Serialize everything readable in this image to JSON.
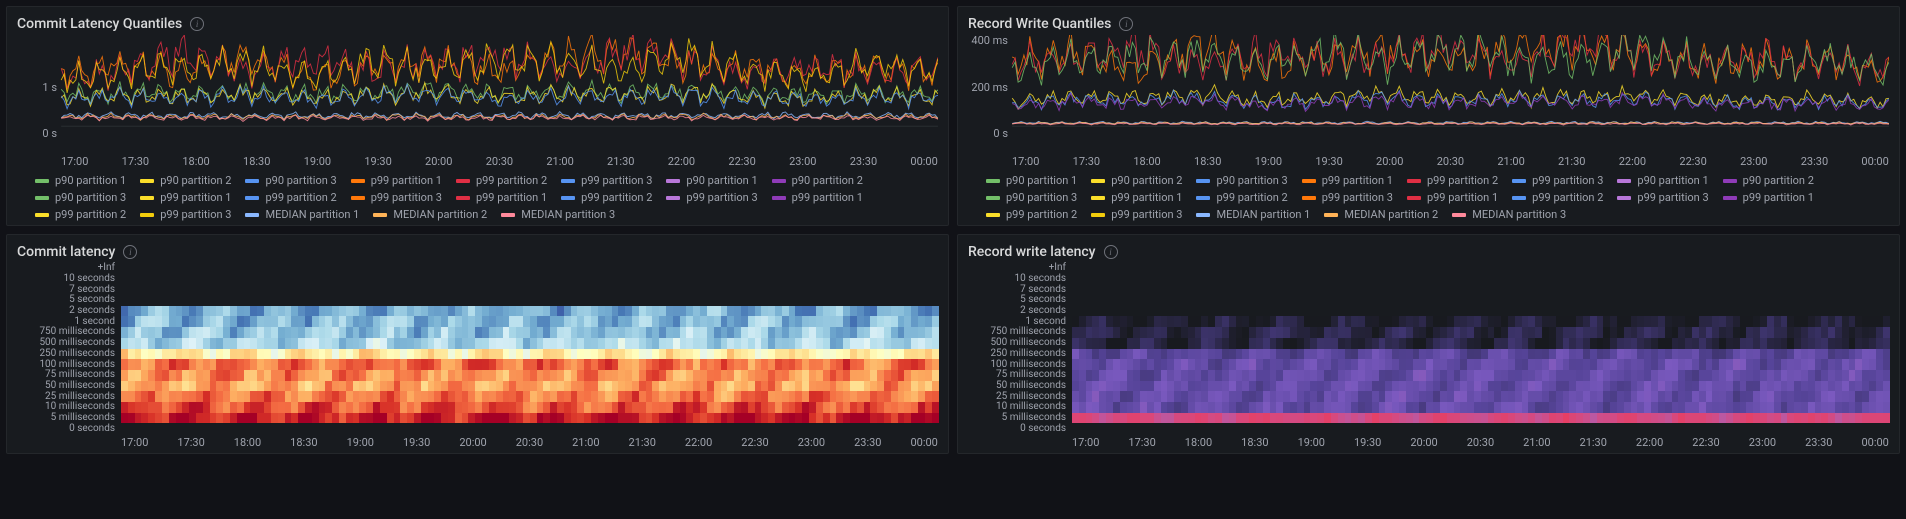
{
  "time_ticks": [
    "17:00",
    "17:30",
    "18:00",
    "18:30",
    "19:00",
    "19:30",
    "20:00",
    "20:30",
    "21:00",
    "21:30",
    "22:00",
    "22:30",
    "23:00",
    "23:30",
    "00:00"
  ],
  "panels": {
    "commit_quantiles": {
      "title": "Commit Latency Quantiles",
      "y_ticks": [
        "1 s",
        "0 s"
      ],
      "legend": [
        {
          "label": "p90 partition 1",
          "color": "#73BF69"
        },
        {
          "label": "p90 partition 2",
          "color": "#FADE2A"
        },
        {
          "label": "p90 partition 3",
          "color": "#5794F2"
        },
        {
          "label": "p99 partition 1",
          "color": "#FF780A"
        },
        {
          "label": "p99 partition 2",
          "color": "#E02F44"
        },
        {
          "label": "p99 partition 3",
          "color": "#5794F2"
        },
        {
          "label": "p90 partition 1",
          "color": "#B877D9"
        },
        {
          "label": "p90 partition 2",
          "color": "#8F3BB8"
        },
        {
          "label": "p90 partition 3",
          "color": "#73BF69"
        },
        {
          "label": "p99 partition 1",
          "color": "#FADE2A"
        },
        {
          "label": "p99 partition 2",
          "color": "#5794F2"
        },
        {
          "label": "p99 partition 3",
          "color": "#FF780A"
        },
        {
          "label": "p99 partition 1",
          "color": "#E02F44"
        },
        {
          "label": "p99 partition 2",
          "color": "#5794F2"
        },
        {
          "label": "p99 partition 3",
          "color": "#B877D9"
        },
        {
          "label": "p99 partition 1",
          "color": "#8F3BB8"
        },
        {
          "label": "p99 partition 2",
          "color": "#FADE2A"
        },
        {
          "label": "p99 partition 3",
          "color": "#F2CC0C"
        },
        {
          "label": "MEDIAN partition 1",
          "color": "#8AB8FF"
        },
        {
          "label": "MEDIAN partition 2",
          "color": "#FFB357"
        },
        {
          "label": "MEDIAN partition 3",
          "color": "#FF899B"
        }
      ]
    },
    "record_quantiles": {
      "title": "Record Write Quantiles",
      "y_ticks": [
        "400 ms",
        "200 ms",
        "0 s"
      ],
      "legend": [
        {
          "label": "p90 partition 1",
          "color": "#73BF69"
        },
        {
          "label": "p90 partition 2",
          "color": "#FADE2A"
        },
        {
          "label": "p90 partition 3",
          "color": "#5794F2"
        },
        {
          "label": "p99 partition 1",
          "color": "#FF780A"
        },
        {
          "label": "p99 partition 2",
          "color": "#E02F44"
        },
        {
          "label": "p99 partition 3",
          "color": "#5794F2"
        },
        {
          "label": "p90 partition 1",
          "color": "#B877D9"
        },
        {
          "label": "p90 partition 2",
          "color": "#8F3BB8"
        },
        {
          "label": "p90 partition 3",
          "color": "#73BF69"
        },
        {
          "label": "p99 partition 1",
          "color": "#FADE2A"
        },
        {
          "label": "p99 partition 2",
          "color": "#5794F2"
        },
        {
          "label": "p99 partition 3",
          "color": "#FF780A"
        },
        {
          "label": "p99 partition 1",
          "color": "#E02F44"
        },
        {
          "label": "p99 partition 2",
          "color": "#5794F2"
        },
        {
          "label": "p99 partition 3",
          "color": "#B877D9"
        },
        {
          "label": "p99 partition 1",
          "color": "#8F3BB8"
        },
        {
          "label": "p99 partition 2",
          "color": "#FADE2A"
        },
        {
          "label": "p99 partition 3",
          "color": "#F2CC0C"
        },
        {
          "label": "MEDIAN partition 1",
          "color": "#8AB8FF"
        },
        {
          "label": "MEDIAN partition 2",
          "color": "#FFB357"
        },
        {
          "label": "MEDIAN partition 3",
          "color": "#FF899B"
        }
      ]
    },
    "commit_latency": {
      "title": "Commit latency",
      "buckets": [
        "+Inf",
        "10 seconds",
        "7 seconds",
        "5 seconds",
        "2 seconds",
        "1 second",
        "750 milliseconds",
        "500 milliseconds",
        "250 milliseconds",
        "100 milliseconds",
        "75 milliseconds",
        "50 milliseconds",
        "25 milliseconds",
        "10 milliseconds",
        "5 milliseconds",
        "0 seconds"
      ]
    },
    "record_latency": {
      "title": "Record write latency",
      "buckets": [
        "+Inf",
        "10 seconds",
        "7 seconds",
        "5 seconds",
        "2 seconds",
        "1 second",
        "750 milliseconds",
        "500 milliseconds",
        "250 milliseconds",
        "100 milliseconds",
        "75 milliseconds",
        "50 milliseconds",
        "25 milliseconds",
        "10 milliseconds",
        "5 milliseconds",
        "0 seconds"
      ]
    }
  },
  "chart_data": [
    {
      "panel": "commit_quantiles",
      "type": "line",
      "title": "Commit Latency Quantiles",
      "xlabel": "time",
      "ylabel": "latency",
      "x_range": [
        "16:45",
        "00:15"
      ],
      "y_range_seconds": [
        0,
        1.6
      ],
      "note": "dense multi-series noisy lines; representative sampled values (seconds) at each half-hour tick",
      "x": [
        "17:00",
        "17:30",
        "18:00",
        "18:30",
        "19:00",
        "19:30",
        "20:00",
        "20:30",
        "21:00",
        "21:30",
        "22:00",
        "22:30",
        "23:00",
        "23:30",
        "00:00"
      ],
      "series": [
        {
          "name": "p99 partition 1",
          "color": "#FF780A",
          "values": [
            0.9,
            1.1,
            0.95,
            1.2,
            0.85,
            1.05,
            1.15,
            0.95,
            1.25,
            1.3,
            1.1,
            1.0,
            0.95,
            1.05,
            0.9
          ]
        },
        {
          "name": "p99 partition 2",
          "color": "#E02F44",
          "values": [
            0.85,
            1.0,
            1.3,
            0.9,
            1.2,
            1.0,
            1.1,
            1.25,
            0.95,
            1.35,
            1.15,
            0.9,
            1.05,
            0.95,
            1.0
          ]
        },
        {
          "name": "p99 partition 3",
          "color": "#F2CC0C",
          "values": [
            0.8,
            0.95,
            1.05,
            1.1,
            0.9,
            1.15,
            1.0,
            1.2,
            1.1,
            1.0,
            1.25,
            0.95,
            0.85,
            1.1,
            0.95
          ]
        },
        {
          "name": "p90 partition 1",
          "color": "#73BF69",
          "values": [
            0.55,
            0.6,
            0.58,
            0.62,
            0.55,
            0.6,
            0.65,
            0.58,
            0.62,
            0.6,
            0.63,
            0.57,
            0.55,
            0.6,
            0.55
          ]
        },
        {
          "name": "p90 partition 2",
          "color": "#FADE2A",
          "values": [
            0.5,
            0.55,
            0.52,
            0.58,
            0.5,
            0.56,
            0.6,
            0.54,
            0.58,
            0.56,
            0.6,
            0.52,
            0.5,
            0.55,
            0.52
          ]
        },
        {
          "name": "p90 partition 3",
          "color": "#5794F2",
          "values": [
            0.48,
            0.52,
            0.5,
            0.55,
            0.48,
            0.53,
            0.56,
            0.5,
            0.54,
            0.52,
            0.55,
            0.49,
            0.48,
            0.52,
            0.5
          ]
        },
        {
          "name": "MEDIAN partition 1",
          "color": "#8AB8FF",
          "values": [
            0.2,
            0.2,
            0.2,
            0.2,
            0.2,
            0.2,
            0.2,
            0.2,
            0.2,
            0.2,
            0.2,
            0.2,
            0.2,
            0.2,
            0.2
          ]
        },
        {
          "name": "MEDIAN partition 2",
          "color": "#FFB357",
          "values": [
            0.18,
            0.18,
            0.18,
            0.18,
            0.18,
            0.18,
            0.18,
            0.18,
            0.18,
            0.18,
            0.18,
            0.18,
            0.18,
            0.18,
            0.18
          ]
        },
        {
          "name": "MEDIAN partition 3",
          "color": "#FF899B",
          "values": [
            0.16,
            0.16,
            0.16,
            0.16,
            0.16,
            0.16,
            0.16,
            0.16,
            0.16,
            0.16,
            0.16,
            0.16,
            0.16,
            0.16,
            0.16
          ]
        }
      ]
    },
    {
      "panel": "record_quantiles",
      "type": "line",
      "title": "Record Write Quantiles",
      "xlabel": "time",
      "ylabel": "latency",
      "x_range": [
        "16:45",
        "00:15"
      ],
      "y_range_ms": [
        0,
        420
      ],
      "x": [
        "17:00",
        "17:30",
        "18:00",
        "18:30",
        "19:00",
        "19:30",
        "20:00",
        "20:30",
        "21:00",
        "21:30",
        "22:00",
        "22:30",
        "23:00",
        "23:30",
        "00:00"
      ],
      "series": [
        {
          "name": "p99 partition 1",
          "color": "#FF780A",
          "values": [
            300,
            340,
            260,
            380,
            280,
            320,
            350,
            300,
            360,
            370,
            330,
            290,
            310,
            300,
            250
          ]
        },
        {
          "name": "p99 partition 2",
          "color": "#E02F44",
          "values": [
            280,
            310,
            360,
            270,
            340,
            300,
            330,
            370,
            290,
            380,
            340,
            280,
            320,
            290,
            260
          ]
        },
        {
          "name": "p99 partition 3",
          "color": "#73BF69",
          "values": [
            260,
            300,
            320,
            330,
            280,
            340,
            300,
            350,
            320,
            300,
            360,
            290,
            270,
            310,
            250
          ]
        },
        {
          "name": "p90 partition 1",
          "color": "#FADE2A",
          "values": [
            120,
            140,
            130,
            150,
            120,
            135,
            145,
            130,
            140,
            135,
            145,
            125,
            120,
            130,
            110
          ]
        },
        {
          "name": "p90 partition 2",
          "color": "#5794F2",
          "values": [
            110,
            125,
            118,
            135,
            110,
            122,
            132,
            118,
            128,
            122,
            130,
            115,
            110,
            120,
            100
          ]
        },
        {
          "name": "p90 partition 3",
          "color": "#8F3BB8",
          "values": [
            100,
            115,
            108,
            122,
            100,
            112,
            120,
            108,
            118,
            112,
            120,
            105,
            100,
            110,
            95
          ]
        },
        {
          "name": "MEDIAN partition 1",
          "color": "#8AB8FF",
          "values": [
            20,
            20,
            20,
            20,
            20,
            20,
            20,
            20,
            20,
            20,
            20,
            20,
            20,
            20,
            20
          ]
        },
        {
          "name": "MEDIAN partition 2",
          "color": "#FFB357",
          "values": [
            18,
            18,
            18,
            18,
            18,
            18,
            18,
            18,
            18,
            18,
            18,
            18,
            18,
            18,
            18
          ]
        },
        {
          "name": "MEDIAN partition 3",
          "color": "#FF899B",
          "values": [
            15,
            15,
            15,
            15,
            15,
            15,
            15,
            15,
            15,
            15,
            15,
            15,
            15,
            15,
            15
          ]
        }
      ]
    },
    {
      "panel": "commit_latency",
      "type": "heatmap",
      "title": "Commit latency",
      "xlabel": "time",
      "ylabel": "bucket",
      "x": [
        "17:00",
        "17:30",
        "18:00",
        "18:30",
        "19:00",
        "19:30",
        "20:00",
        "20:30",
        "21:00",
        "21:30",
        "22:00",
        "22:30",
        "23:00",
        "23:30",
        "00:00"
      ],
      "y_buckets": [
        "+Inf",
        "10 seconds",
        "7 seconds",
        "5 seconds",
        "2 seconds",
        "1 second",
        "750 milliseconds",
        "500 milliseconds",
        "250 milliseconds",
        "100 milliseconds",
        "75 milliseconds",
        "50 milliseconds",
        "25 milliseconds",
        "10 milliseconds",
        "5 milliseconds",
        "0 seconds"
      ],
      "intensity_scale": "spectral-reversed (blue=low, red=high)",
      "row_intensity_0to1": [
        0,
        0,
        0,
        0,
        0.2,
        0.22,
        0.25,
        0.3,
        0.55,
        0.8,
        0.75,
        0.72,
        0.78,
        0.85,
        0.95,
        0
      ]
    },
    {
      "panel": "record_latency",
      "type": "heatmap",
      "title": "Record write latency",
      "xlabel": "time",
      "ylabel": "bucket",
      "x": [
        "17:00",
        "17:30",
        "18:00",
        "18:30",
        "19:00",
        "19:30",
        "20:00",
        "20:30",
        "21:00",
        "21:30",
        "22:00",
        "22:30",
        "23:00",
        "23:30",
        "00:00"
      ],
      "y_buckets": [
        "+Inf",
        "10 seconds",
        "7 seconds",
        "5 seconds",
        "2 seconds",
        "1 second",
        "750 milliseconds",
        "500 milliseconds",
        "250 milliseconds",
        "100 milliseconds",
        "75 milliseconds",
        "50 milliseconds",
        "25 milliseconds",
        "10 milliseconds",
        "5 milliseconds",
        "0 seconds"
      ],
      "intensity_scale": "purple-pink (dark=low, bright=high)",
      "row_intensity_0to1": [
        0,
        0,
        0,
        0,
        0,
        0.05,
        0.1,
        0.08,
        0.35,
        0.4,
        0.4,
        0.4,
        0.4,
        0.4,
        0.85,
        0
      ]
    }
  ]
}
